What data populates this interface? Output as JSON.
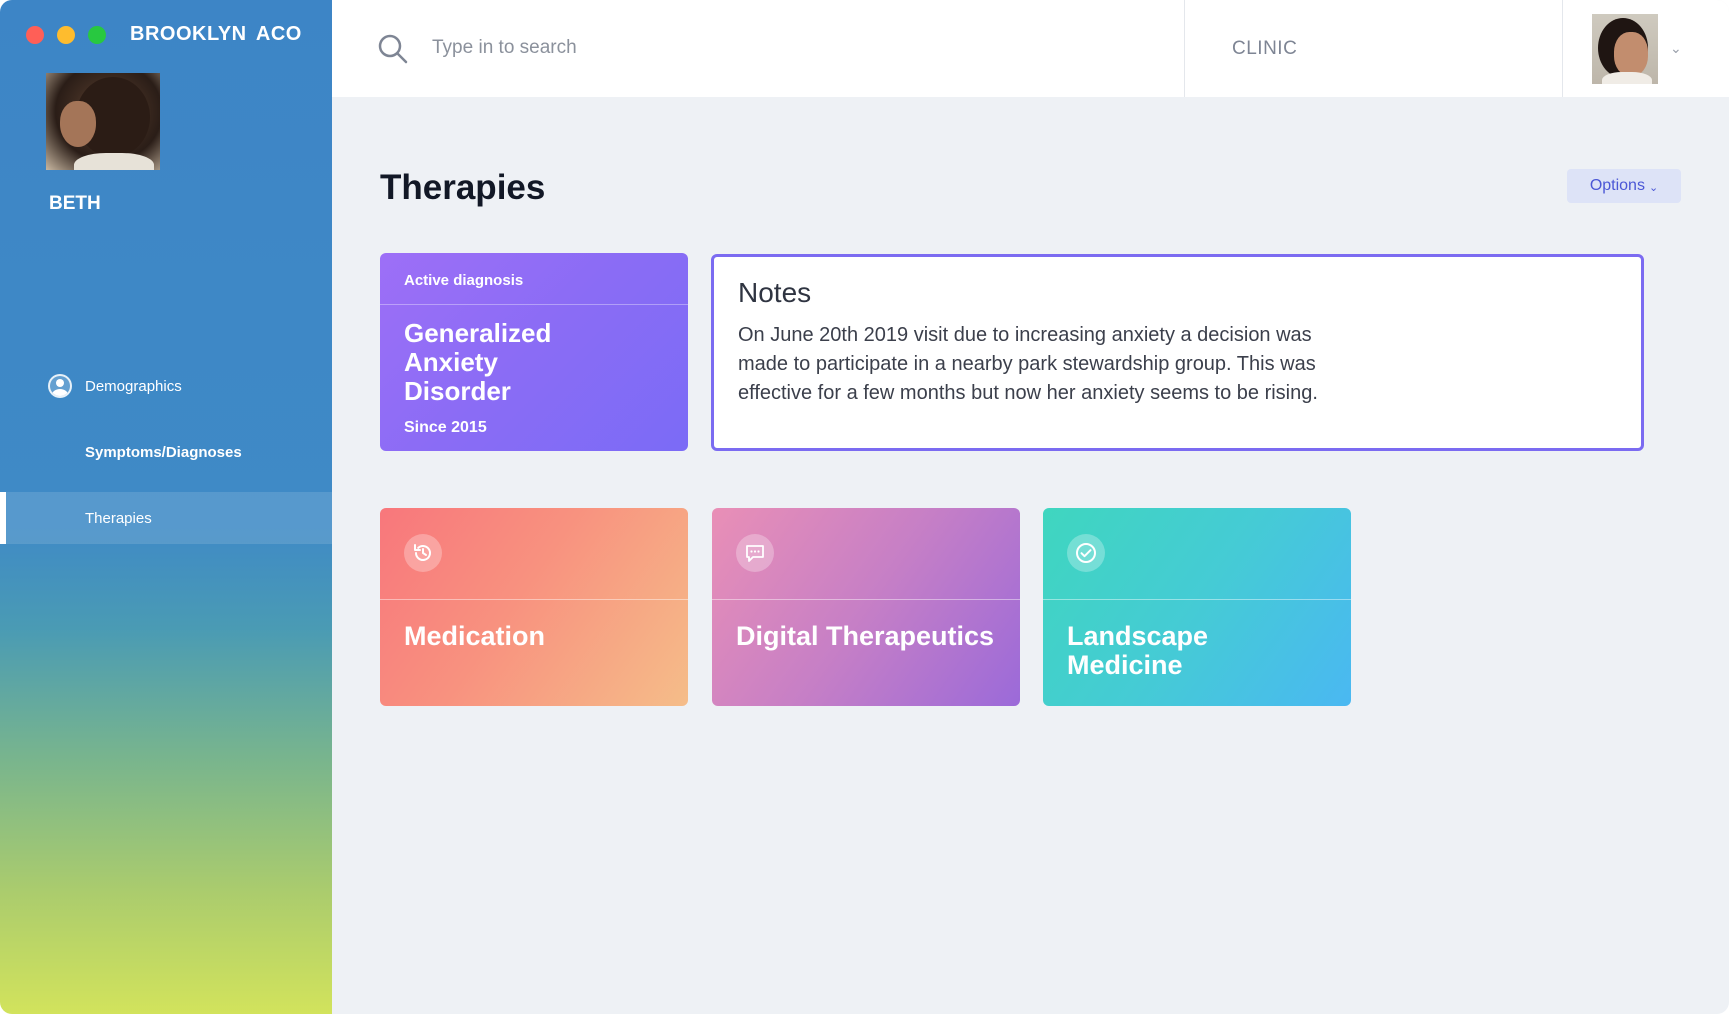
{
  "app": {
    "name": "BROOKLYN ACO"
  },
  "patient": {
    "name": "BETH"
  },
  "sidebar": {
    "items": [
      {
        "label": "Demographics",
        "icon": "user-circle-icon"
      },
      {
        "label": "Symptoms/Diagnoses"
      },
      {
        "label": "Therapies",
        "active": true
      }
    ]
  },
  "topbar": {
    "search_placeholder": "Type in to search",
    "clinic_label": "CLINIC"
  },
  "main": {
    "title": "Therapies",
    "options_label": "Options",
    "diagnosis": {
      "header": "Active diagnosis",
      "title": "Generalized Anxiety Disorder",
      "since": "Since 2015"
    },
    "notes": {
      "title": "Notes",
      "body": "On June 20th 2019 visit due to increasing anxiety a decision was made to participate in a nearby park stewardship group. This was effective for a few months but now her anxiety seems to be rising."
    },
    "therapies": [
      {
        "label": "Medication",
        "icon": "history-clock-icon"
      },
      {
        "label": "Digital Therapeutics",
        "icon": "chat-bubble-icon"
      },
      {
        "label": "Landscape Medicine",
        "icon": "check-circle-icon"
      }
    ]
  },
  "colors": {
    "accent": "#7b6bf1",
    "sidebar_top": "#3d85c6",
    "sidebar_bottom": "#d2e35c"
  }
}
